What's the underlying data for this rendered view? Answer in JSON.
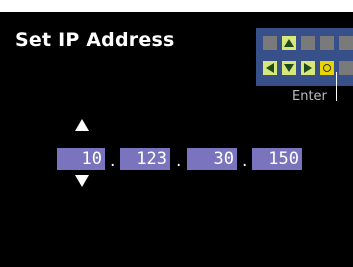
{
  "title": "Set IP Address",
  "ip": {
    "octet1": "10",
    "octet2": "123",
    "octet3": "30",
    "octet4": "150",
    "separator": "."
  },
  "keypad": {
    "enter_label": "Enter"
  },
  "colors": {
    "octet_bg": "#7a74bf",
    "keypad_bg": "#37508a",
    "key_active": "#d7e77a",
    "key_enter": "#e8d400"
  }
}
